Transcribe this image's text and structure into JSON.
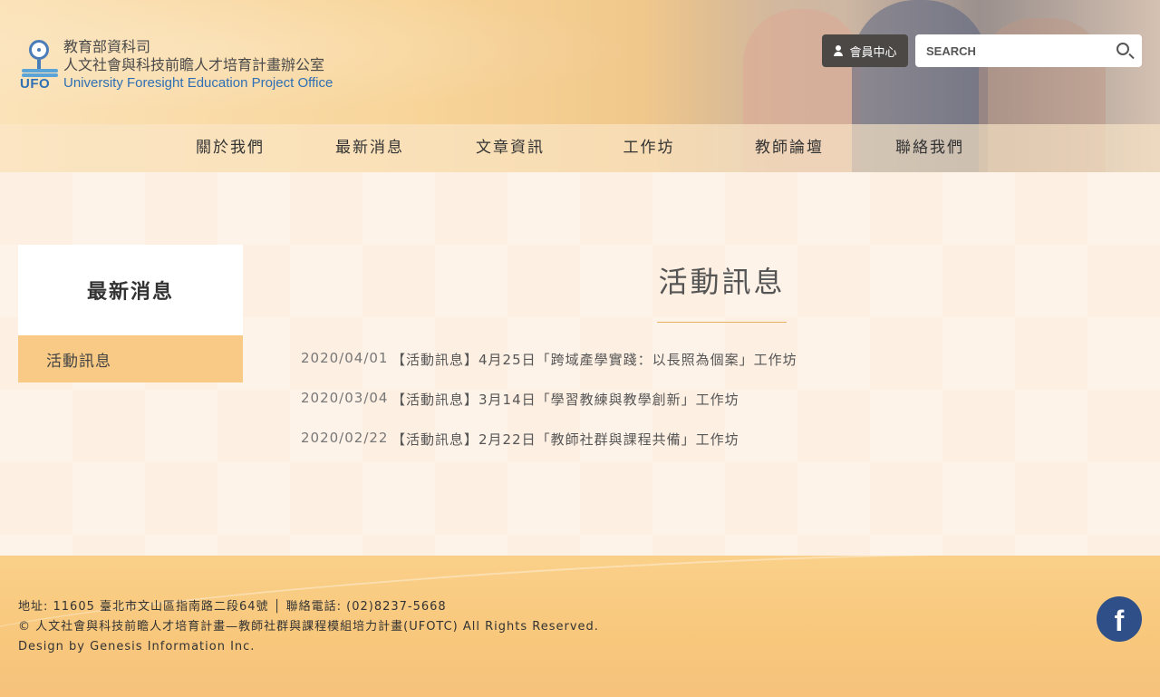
{
  "header": {
    "logo": {
      "mark_text": "UFO",
      "line1": "教育部資科司",
      "line2": "人文社會與科技前瞻人才培育計畫辦公室",
      "line3": "University Foresight Education Project Office"
    },
    "member_label": "會員中心",
    "search": {
      "placeholder": "SEARCH",
      "value": ""
    },
    "nav": [
      {
        "label": "關於我們"
      },
      {
        "label": "最新消息"
      },
      {
        "label": "文章資訊"
      },
      {
        "label": "工作坊"
      },
      {
        "label": "教師論壇"
      },
      {
        "label": "聯絡我們"
      }
    ]
  },
  "sidebar": {
    "title": "最新消息",
    "items": [
      {
        "label": "活動訊息",
        "active": true
      }
    ]
  },
  "content": {
    "title": "活動訊息",
    "news": [
      {
        "date": "2020/04/01",
        "title": "【活動訊息】4月25日「跨域產學實踐：以長照為個案」工作坊"
      },
      {
        "date": "2020/03/04",
        "title": "【活動訊息】3月14日「學習教練與教學創新」工作坊"
      },
      {
        "date": "2020/02/22",
        "title": "【活動訊息】2月22日「教師社群與課程共備」工作坊"
      }
    ]
  },
  "footer": {
    "address": "地址: 11605 臺北市文山區指南路二段64號 │ 聯絡電話: (02)8237-5668",
    "copyright": "© 人文社會與科技前瞻人才培育計畫—教師社群與課程模組培力計畫(UFOTC) All Rights Reserved.",
    "design": "Design by Genesis Information Inc.",
    "social_icon": "facebook-icon"
  },
  "colors": {
    "accent": "#f8ca85",
    "footer_bg": "#f8c77c",
    "member_bg": "#4b4846",
    "facebook": "#2f4f88"
  }
}
